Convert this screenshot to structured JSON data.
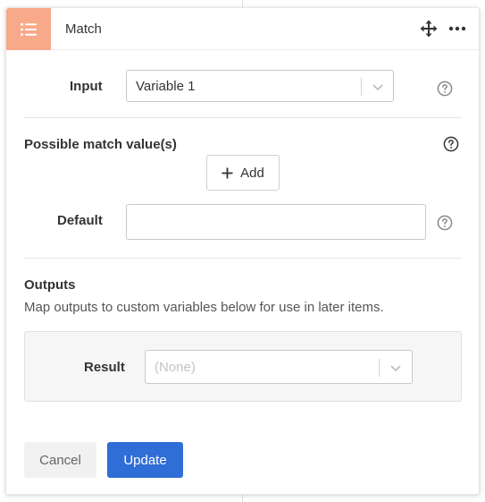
{
  "header": {
    "title": "Match",
    "icon": "list-icon",
    "accent_color": "#f7a98a"
  },
  "input_field": {
    "label": "Input",
    "value": "Variable 1"
  },
  "match_values": {
    "label": "Possible match value(s)",
    "add_label": "Add"
  },
  "default_field": {
    "label": "Default",
    "value": "",
    "placeholder": ""
  },
  "outputs": {
    "title": "Outputs",
    "description": "Map outputs to custom variables below for use in later items.",
    "result_label": "Result",
    "result_value": "(None)"
  },
  "actions": {
    "cancel_label": "Cancel",
    "update_label": "Update",
    "primary_color": "#2f6ed6"
  }
}
